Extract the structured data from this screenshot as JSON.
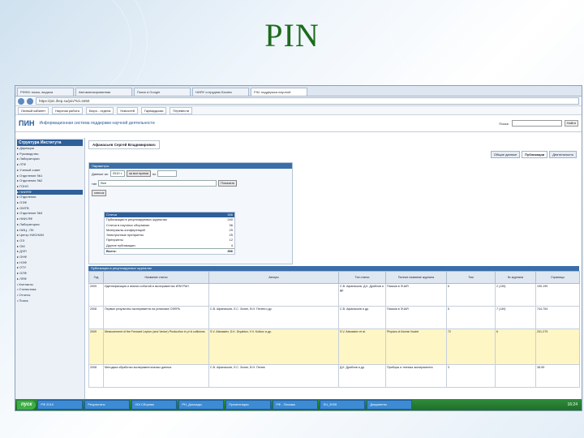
{
  "slide": {
    "title": "PIN"
  },
  "browser": {
    "tabs": [
      "РФФИ: поиск, выдача",
      "Автоматизированная",
      "Поиск в Google",
      "НИЯУ сотрудник Бизнес",
      "PIN: поддержка научной"
    ],
    "url": "https://pin.ihep.su/pin/?id=3450",
    "bookmarks": [
      "Личный кабинет",
      "Научная работа",
      "Бюро - отдела",
      "Новостей",
      "Гарвардская",
      "Перевести"
    ]
  },
  "site": {
    "logo": "ПИН",
    "name": "Информационная система поддержки научной деятельности",
    "search_label": "Поиск:",
    "search_button": "Найти"
  },
  "sidebar": {
    "header": "Структура Института",
    "items": [
      "Дирекция",
      "Руководство",
      "Лаборатории",
      "ЛТФ",
      "Ученый совет",
      "Отделение №1",
      "Отделение №2",
      "ГОНО",
      "НИИЯФ",
      "Отделение",
      "ОЭФ",
      "ОМТВ",
      "Отделение №3",
      "НИИ-ЯФ",
      "Лаборатория",
      "НИЦ - ПК",
      "Центр НИСНИИ",
      "ОЭ",
      "ОМ",
      "ДЭП",
      "ОНФ",
      "НЭФ",
      "ОТУ",
      "ОЛФ",
      "ЛЯФ"
    ],
    "selected": 8,
    "bottom": [
      "Контакты",
      "Статистика",
      "Отчеты",
      "Поиск"
    ]
  },
  "content": {
    "person": "Афанасьев Сергей Владимирович",
    "tabs": [
      "Общие данные",
      "Публикации",
      "Деятельность"
    ],
    "active_tab": 1,
    "filter": {
      "header": "Параметры",
      "from_label": "Данные за:",
      "from_value": "2010 г.",
      "all_time": "за все время",
      "to_label": "по",
      "type_label": "тип",
      "type_value": "Все",
      "show_button": "Показать",
      "list_label": "список"
    },
    "categories": [
      {
        "name": "Статьи",
        "count": "346"
      },
      {
        "name": "Публикации в рецензируемых журналах",
        "count": "240"
      },
      {
        "name": "Статьи в научных сборниках",
        "count": "36"
      },
      {
        "name": "Материалы конференций",
        "count": "29"
      },
      {
        "name": "Электронные препринты",
        "count": "25"
      },
      {
        "name": "Препринты",
        "count": "12"
      },
      {
        "name": "Другие публикации",
        "count": "4"
      }
    ],
    "total_label": "Всего:",
    "total_value": "396",
    "table": {
      "caption": "Публикации в рецензируемых журналах",
      "headers": [
        "Год",
        "Название статьи",
        "Авторы",
        "Тип статьи",
        "Полное название журнала",
        "Том",
        "№ журнала",
        "Страницы"
      ],
      "rows": [
        [
          "2009",
          "Идентификация и анализ событий в экспериментах ИЯИ РАН",
          "",
          "С.В. Афанасьев, Д.К. Дряблов и др.",
          "Письма в ЭЧАЯ",
          "6",
          "2 (135)",
          "190-199"
        ],
        [
          "2008",
          "Первые результаты эксперимента на установке СФЕРА",
          "С.В. Афанасьев, Л.С. Золин, В.Н. Пенев и др.",
          "С.В. Афанасьев и др.",
          "Письма в ЭЧАЯ",
          "5",
          "7 (149)",
          "744-754"
        ],
        [
          "2009",
          "Measurement of the Forward Lepton (and Vector) Production in p+A collisions",
          "S.V. Afanasiev, D.K. Dryablov, V.V. Kotkov и др.",
          "S.V. Afanasiev et al.",
          "Physics of Atomic Nuclei",
          "72",
          "6",
          "201-279"
        ],
        [
          "2008",
          "Методика обработки экспериментальных данных",
          "С.В. Афанасьев, Л.С. Золин, В.Н. Пенев",
          "Д.К. Дряблов и др.",
          "Приборы и техника эксперимента",
          "3",
          "",
          "38-59"
        ]
      ]
    }
  },
  "taskbar": {
    "start": "пуск",
    "tasks": [
      "РФ 2010",
      "Результаты",
      "VDI Сборник",
      "РН_Доклады",
      "Презентация",
      "РФ - Письма",
      "ЭЧ_2009",
      "Документы"
    ],
    "clock": "16:24"
  },
  "colors": {
    "title": "#1d6b1d",
    "accent": "#2e5f99",
    "taskbar": "#2e8e3a"
  }
}
